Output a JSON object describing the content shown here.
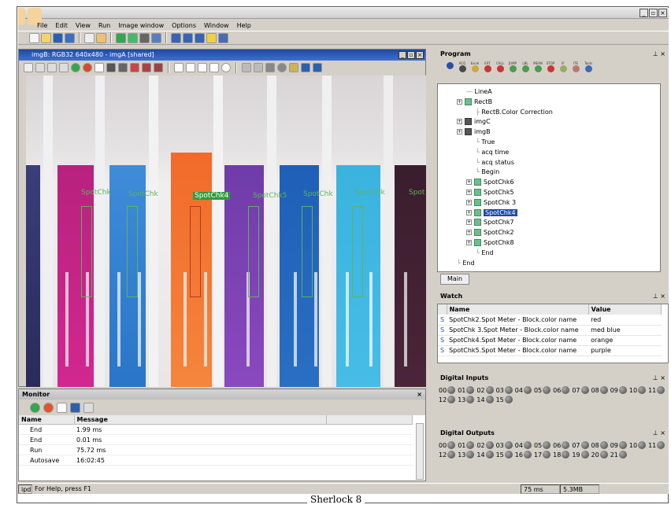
{
  "caption": "Sherlock 8",
  "menu": [
    "File",
    "Edit",
    "View",
    "Run",
    "Image window",
    "Options",
    "Window",
    "Help"
  ],
  "image_window": {
    "title": "imgB: RGB32 640x480 - imgA [shared]",
    "spot_labels": [
      "SpotChk",
      "SpotChk",
      "SpotChk4",
      "SpotChk5",
      "SpotChk",
      "SpotChk",
      "Spot"
    ],
    "active_label": "SpotChk4"
  },
  "program": {
    "title": "Program",
    "icon_labels": [
      "",
      "ACQ",
      "Excel",
      "EXT",
      "CALL",
      "JUMP",
      "LBL",
      "MEAN",
      "STOP",
      "IF",
      "ITE",
      "Tools"
    ],
    "tree": [
      {
        "label": "LineA",
        "indent": 2,
        "type": "line"
      },
      {
        "label": "RectB",
        "indent": 1,
        "type": "node"
      },
      {
        "label": "RectB.Color Correction",
        "indent": 3,
        "type": "sub"
      },
      {
        "label": "imgC",
        "indent": 1,
        "type": "img"
      },
      {
        "label": "imgB",
        "indent": 1,
        "type": "img"
      },
      {
        "label": "True",
        "indent": 3,
        "type": "leaf"
      },
      {
        "label": "acq time",
        "indent": 3,
        "type": "leaf"
      },
      {
        "label": "acq status",
        "indent": 3,
        "type": "leaf"
      },
      {
        "label": "Begin",
        "indent": 3,
        "type": "leaf"
      },
      {
        "label": "SpotChk6",
        "indent": 2,
        "type": "node"
      },
      {
        "label": "SpotChk5",
        "indent": 2,
        "type": "node"
      },
      {
        "label": "SpotChk 3",
        "indent": 2,
        "type": "node"
      },
      {
        "label": "SpotChk4",
        "indent": 2,
        "type": "node",
        "selected": true
      },
      {
        "label": "SpotChk7",
        "indent": 2,
        "type": "node"
      },
      {
        "label": "SpotChk2",
        "indent": 2,
        "type": "node"
      },
      {
        "label": "SpotChk8",
        "indent": 2,
        "type": "node"
      },
      {
        "label": "End",
        "indent": 3,
        "type": "leaf"
      },
      {
        "label": "End",
        "indent": 1,
        "type": "leaf"
      }
    ],
    "tab": "Main"
  },
  "watch": {
    "title": "Watch",
    "headers": [
      "Name",
      "Value"
    ],
    "rows": [
      {
        "name": "SpotChk2.Spot Meter - Block.color name",
        "value": "red"
      },
      {
        "name": "SpotChk 3.Spot Meter - Block.color name",
        "value": "med blue"
      },
      {
        "name": "SpotChk4.Spot Meter - Block.color name",
        "value": "orange"
      },
      {
        "name": "SpotChk5.Spot Meter - Block.color name",
        "value": "purple"
      }
    ]
  },
  "digital_inputs": {
    "title": "Digital Inputs",
    "items": [
      "00",
      "01",
      "02",
      "03",
      "04",
      "05",
      "06",
      "07",
      "08",
      "09",
      "10",
      "11",
      "12",
      "13",
      "14",
      "15"
    ]
  },
  "digital_outputs": {
    "title": "Digital Outputs",
    "items": [
      "00",
      "01",
      "02",
      "03",
      "04",
      "05",
      "06",
      "07",
      "08",
      "09",
      "10",
      "11",
      "12",
      "13",
      "14",
      "15",
      "16",
      "17",
      "18",
      "19",
      "20",
      "21"
    ]
  },
  "monitor": {
    "title": "Monitor",
    "headers": [
      "Name",
      "Message"
    ],
    "rows": [
      {
        "name": "End",
        "message": "1.99 ms"
      },
      {
        "name": "End",
        "message": "0.01 ms"
      },
      {
        "name": "Run",
        "message": "75.72 ms"
      },
      {
        "name": "Autosave",
        "message": "16:02:45"
      }
    ]
  },
  "status": {
    "indicator": "ipd",
    "help": "For Help, press F1",
    "time": "75 ms",
    "memory": "5.3MB"
  }
}
